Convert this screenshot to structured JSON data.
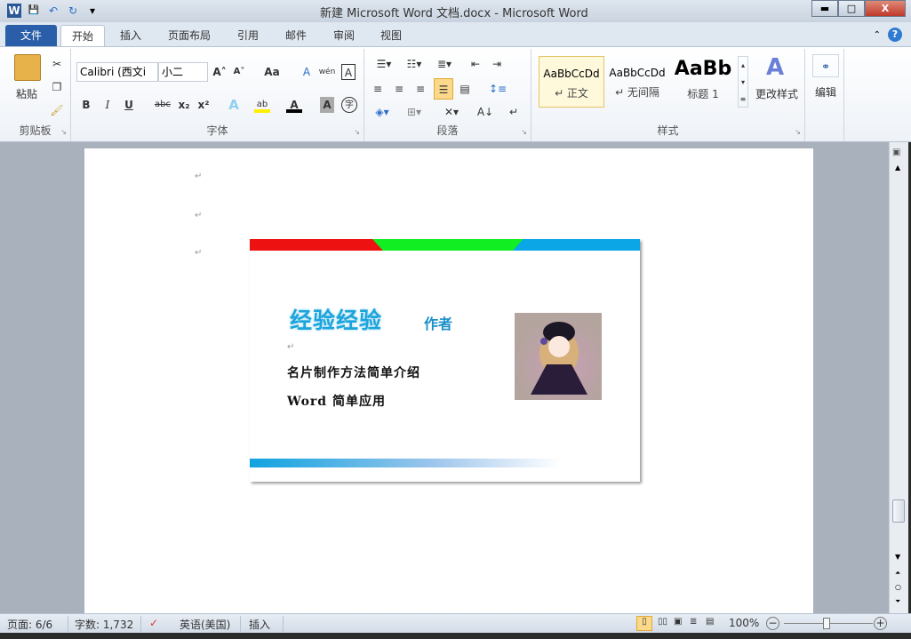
{
  "window": {
    "title": "新建 Microsoft Word 文档.docx - Microsoft Word",
    "minimize": "▬",
    "maximize": "□",
    "close": "X"
  },
  "quick_access": {
    "word_icon": "W",
    "save": "💾",
    "undo": "↶",
    "redo": "↻",
    "customize": "▾"
  },
  "tabs": [
    "文件",
    "开始",
    "插入",
    "页面布局",
    "引用",
    "邮件",
    "审阅",
    "视图"
  ],
  "ribbon": {
    "clipboard": {
      "label": "剪贴板",
      "paste": "粘贴"
    },
    "font": {
      "label": "字体",
      "font_name": "Calibri (西文i",
      "font_size": "小二",
      "bold": "B",
      "italic": "I",
      "underline": "U",
      "strike": "abc",
      "sub": "x₂",
      "sup": "x²",
      "grow": "A˄",
      "shrink": "A˅",
      "case": "Aa",
      "clear": "A",
      "phonetic": "wén",
      "border_char": "A",
      "effect": "A",
      "highlight": "ab",
      "color": "A",
      "shade": "A",
      "enclose": "字"
    },
    "paragraph": {
      "label": "段落"
    },
    "styles": {
      "label": "样式",
      "items": [
        {
          "preview": "AaBbCcDd",
          "name": "↵ 正文"
        },
        {
          "preview": "AaBbCcDd",
          "name": "↵ 无间隔"
        },
        {
          "preview": "AaBb",
          "name": "标题 1"
        }
      ],
      "change": "更改样式"
    },
    "editing": {
      "label": "编辑"
    }
  },
  "card": {
    "name": "经验经验",
    "author": "作者",
    "line1": "名片制作方法简单介绍",
    "line2": "Word 简单应用",
    "colors": {
      "red": "#ee1111",
      "green": "#11ee22",
      "blue": "#0aa6e6"
    }
  },
  "status": {
    "page": "页面: 6/6",
    "words": "字数: 1,732",
    "language": "英语(美国)",
    "mode": "插入",
    "zoom": "100%",
    "zoom_percent": 100
  }
}
